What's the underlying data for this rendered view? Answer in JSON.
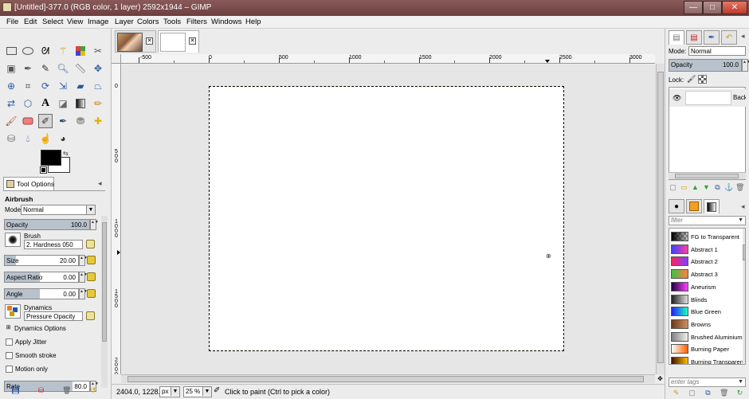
{
  "window": {
    "title": "[Untitled]-377.0 (RGB color, 1 layer) 2592x1944 – GIMP",
    "minimize": "—",
    "maximize": "□",
    "close": "✕"
  },
  "menu": [
    "File",
    "Edit",
    "Select",
    "View",
    "Image",
    "Layer",
    "Colors",
    "Tools",
    "Filters",
    "Windows",
    "Help"
  ],
  "toolbox": {
    "tools": [
      "rect-select",
      "ellipse-select",
      "free-select",
      "fuzzy-select",
      "select-by-color",
      "scissors",
      "foreground-select",
      "paths",
      "color-picker",
      "zoom",
      "measure",
      "move",
      "align",
      "crop",
      "rotate",
      "scale",
      "shear",
      "perspective",
      "flip",
      "cage",
      "text",
      "bucket-fill",
      "blend",
      "pencil",
      "paintbrush",
      "eraser",
      "airbrush",
      "ink",
      "clone",
      "heal",
      "perspective-clone",
      "blur",
      "smudge",
      "dodge-burn"
    ],
    "selected_tool": "airbrush"
  },
  "tool_options": {
    "tab_label": "Tool Options",
    "tool_name": "Airbrush",
    "mode_label": "Mode:",
    "mode_value": "Normal",
    "opacity_label": "Opacity",
    "opacity_value": "100.0",
    "brush_label": "Brush",
    "brush_value": "2. Hardness 050",
    "size_label": "Size",
    "size_value": "20.00",
    "aspect_label": "Aspect Ratio",
    "aspect_value": "0.00",
    "angle_label": "Angle",
    "angle_value": "0.00",
    "dynamics_label": "Dynamics",
    "dynamics_value": "Pressure Opacity",
    "dynamics_options": "Dynamics Options",
    "apply_jitter": "Apply Jitter",
    "smooth_stroke": "Smooth stroke",
    "motion_only": "Motion only",
    "rate_label": "Rate",
    "rate_value": "80.0"
  },
  "image_tabs": [
    {
      "name": "photo-thumbnail"
    },
    {
      "name": "blank-thumbnail"
    }
  ],
  "rulers": {
    "h_labels": [
      "-500",
      "0",
      "500",
      "1000",
      "1500",
      "2000",
      "2500",
      "3000"
    ],
    "v_labels": [
      "0",
      "5\n0\n0",
      "1\n0\n0\n0",
      "1\n5\n0\n0",
      "2\n0\n0\n0"
    ]
  },
  "status": {
    "coords": "2404.0, 1228.0",
    "unit": "px",
    "zoom": "25 %",
    "message": "Click to paint (Ctrl to pick a color)"
  },
  "layers": {
    "mode_label": "Mode:",
    "mode_value": "Normal",
    "opacity_label": "Opacity",
    "opacity_value": "100.0",
    "lock_label": "Lock:",
    "layer_name": "Background"
  },
  "gradients": {
    "filter_placeholder": "filter",
    "tags_placeholder": "enter tags",
    "items": [
      {
        "name": "FG to Transparent",
        "c1": "#000000",
        "c2": "#000000"
      },
      {
        "name": "Abstract 1",
        "c1": "#4040ff",
        "c2": "#ff40a0"
      },
      {
        "name": "Abstract 2",
        "c1": "#ff2060",
        "c2": "#8040ff"
      },
      {
        "name": "Abstract 3",
        "c1": "#40c040",
        "c2": "#ff8040"
      },
      {
        "name": "Aneurism",
        "c1": "#200040",
        "c2": "#ff40ff"
      },
      {
        "name": "Blinds",
        "c1": "#202020",
        "c2": "#e0e0e0"
      },
      {
        "name": "Blue Green",
        "c1": "#2020ff",
        "c2": "#20ffc0"
      },
      {
        "name": "Browns",
        "c1": "#6a3a1a",
        "c2": "#d09060"
      },
      {
        "name": "Brushed Aluminium",
        "c1": "#808080",
        "c2": "#f0f0f0"
      },
      {
        "name": "Burning Paper",
        "c1": "#ffffff",
        "c2": "#ff6000"
      },
      {
        "name": "Burning Transparency",
        "c1": "#401000",
        "c2": "#ffc000"
      }
    ]
  }
}
